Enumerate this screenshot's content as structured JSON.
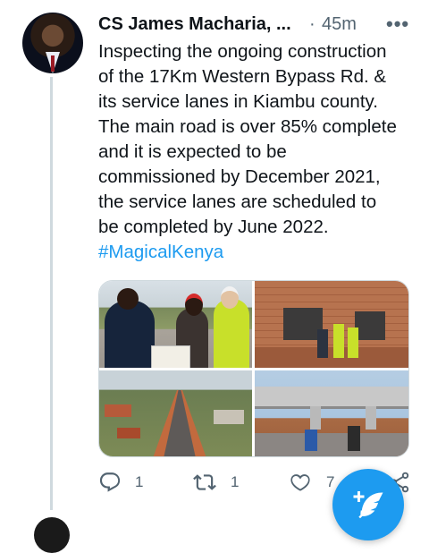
{
  "tweet": {
    "author_name": "CS James Macharia, ...",
    "separator": "·",
    "time": "45m",
    "more_label": "•••",
    "text_lines": [
      "Inspecting the ongoing construction",
      "of the 17Km Western Bypass Rd. &",
      "its service lanes in Kiambu county.",
      "The main road is over 85% complete",
      "and it is expected to be",
      "commissioned by December 2021,",
      "the service lanes are scheduled to",
      "be completed by June 2022."
    ],
    "hashtag": "#MagicalKenya",
    "media_count": 4
  },
  "actions": {
    "reply_count": "1",
    "retweet_count": "1",
    "like_count": "7"
  },
  "icons": {
    "reply": "reply-icon",
    "retweet": "retweet-icon",
    "like": "heart-icon",
    "share": "share-icon",
    "compose": "compose-tweet-icon",
    "more": "more-icon"
  },
  "colors": {
    "accent": "#1d9bf0",
    "text": "#0f1419",
    "secondary": "#536471",
    "border": "#cfd9de"
  }
}
